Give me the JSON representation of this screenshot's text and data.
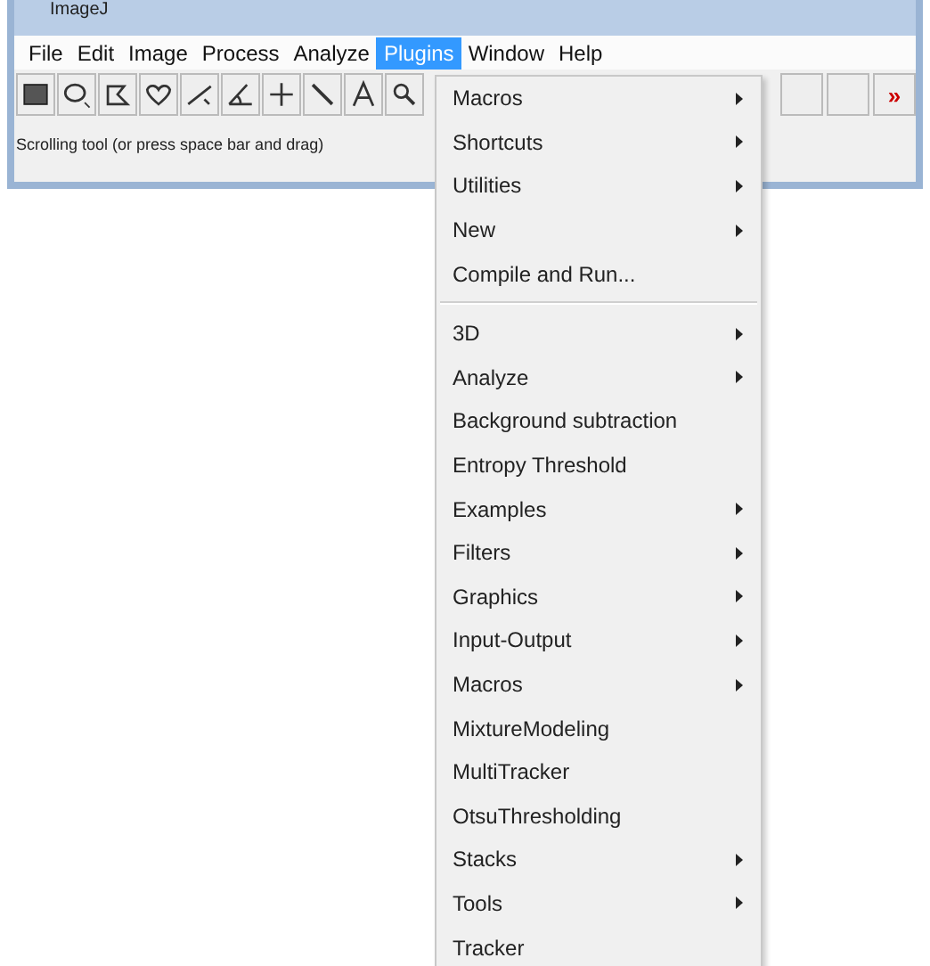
{
  "window": {
    "title": "ImageJ"
  },
  "menu_bar": [
    {
      "label": "File",
      "selected": false
    },
    {
      "label": "Edit",
      "selected": false
    },
    {
      "label": "Image",
      "selected": false
    },
    {
      "label": "Process",
      "selected": false
    },
    {
      "label": "Analyze",
      "selected": false
    },
    {
      "label": "Plugins",
      "selected": true
    },
    {
      "label": "Window",
      "selected": false
    },
    {
      "label": "Help",
      "selected": false
    }
  ],
  "toolbar": {
    "more_button": "»"
  },
  "status_bar": "Scrolling tool (or press space bar and drag)",
  "menu": [
    {
      "kind": "item",
      "label": "Macros",
      "submenu": true
    },
    {
      "kind": "item",
      "label": "Shortcuts",
      "submenu": true
    },
    {
      "kind": "item",
      "label": "Utilities",
      "submenu": true
    },
    {
      "kind": "item",
      "label": "New",
      "submenu": true
    },
    {
      "kind": "item",
      "label": "Compile and Run...",
      "submenu": false
    },
    {
      "kind": "separator"
    },
    {
      "kind": "item",
      "label": "3D",
      "submenu": true
    },
    {
      "kind": "item",
      "label": "Analyze",
      "submenu": true
    },
    {
      "kind": "item",
      "label": "Background subtraction",
      "submenu": false
    },
    {
      "kind": "item",
      "label": "Entropy Threshold",
      "submenu": false
    },
    {
      "kind": "item",
      "label": "Examples",
      "submenu": true
    },
    {
      "kind": "item",
      "label": "Filters",
      "submenu": true
    },
    {
      "kind": "item",
      "label": "Graphics",
      "submenu": true
    },
    {
      "kind": "item",
      "label": "Input-Output",
      "submenu": true
    },
    {
      "kind": "item",
      "label": "Macros",
      "submenu": true
    },
    {
      "kind": "item",
      "label": "MixtureModeling",
      "submenu": false
    },
    {
      "kind": "item",
      "label": "MultiTracker",
      "submenu": false
    },
    {
      "kind": "item",
      "label": "OtsuThresholding",
      "submenu": false
    },
    {
      "kind": "item",
      "label": "Stacks",
      "submenu": true
    },
    {
      "kind": "item",
      "label": "Tools",
      "submenu": true
    },
    {
      "kind": "item",
      "label": "Tracker",
      "submenu": false
    }
  ]
}
